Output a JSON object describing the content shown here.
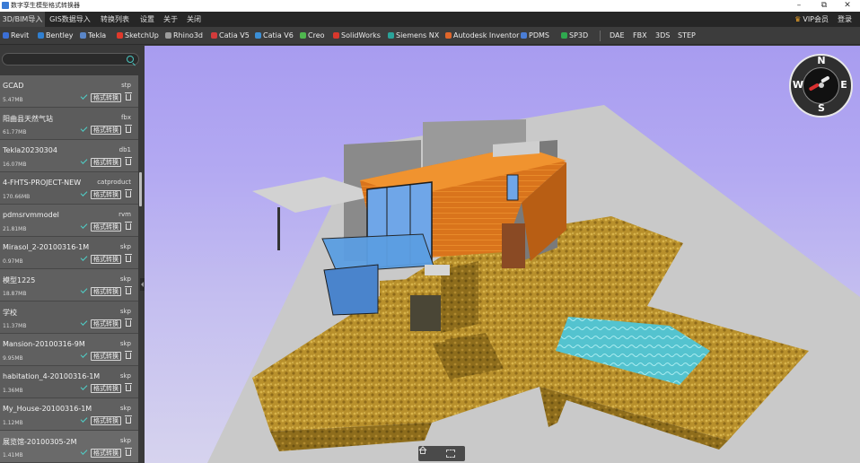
{
  "window": {
    "title": "数字孪生模型格式转换器",
    "controls": [
      "–",
      "⧉",
      "✕"
    ]
  },
  "menu": {
    "items": [
      {
        "label": "3D/BIM导入",
        "active": true
      },
      {
        "label": "GIS数据导入",
        "active": false
      },
      {
        "label": "转换列表",
        "active": false
      },
      {
        "label": "设置",
        "active": false
      },
      {
        "label": "关于",
        "active": false
      },
      {
        "label": "关闭",
        "active": false
      }
    ],
    "vip_label": "VIP会员",
    "login_label": "登录"
  },
  "formats": {
    "items": [
      {
        "label": "Revit",
        "icon": "revit-icon",
        "color": "#3b6fd6"
      },
      {
        "label": "Bentley",
        "icon": "bentley-icon",
        "color": "#2f7fd0"
      },
      {
        "label": "Tekla",
        "icon": "tekla-icon",
        "color": "#5a86c8"
      },
      {
        "label": "SketchUp",
        "icon": "sketchup-icon",
        "color": "#e0392b"
      },
      {
        "label": "Rhino3d",
        "icon": "rhino3d-icon",
        "color": "#9c9c9c"
      },
      {
        "label": "Catia V5",
        "icon": "catia-v5-icon",
        "color": "#d23b3b"
      },
      {
        "label": "Catia V6",
        "icon": "catia-v6-icon",
        "color": "#3b8fd6"
      },
      {
        "label": "Creo",
        "icon": "creo-icon",
        "color": "#4fb74f"
      },
      {
        "label": "SolidWorks",
        "icon": "solidworks-icon",
        "color": "#d8372c"
      },
      {
        "label": "Siemens NX",
        "icon": "siemens-nx-icon",
        "color": "#2aa39a"
      },
      {
        "label": "Autodesk Inventor",
        "icon": "inventor-icon",
        "color": "#e0662a"
      },
      {
        "label": "PDMS",
        "icon": "pdms-icon",
        "color": "#4a7ed6"
      },
      {
        "label": "SP3D",
        "icon": "sp3d-icon",
        "color": "#2fa84f"
      }
    ],
    "plain": [
      "DAE",
      "FBX",
      "3DS",
      "STEP"
    ]
  },
  "sidebar": {
    "search_placeholder": "",
    "convert_label": "格式转换",
    "files": [
      {
        "name": "GCAD",
        "ext": "stp",
        "size": "5.47MB"
      },
      {
        "name": "阳曲县天然气站",
        "ext": "fbx",
        "size": "61.77MB"
      },
      {
        "name": "Tekla20230304",
        "ext": "db1",
        "size": "16.07MB"
      },
      {
        "name": "4-FHTS-PROJECT-NEW",
        "ext": "catproduct",
        "size": "170.66MB"
      },
      {
        "name": "pdmsrvmmodel",
        "ext": "rvm",
        "size": "21.81MB"
      },
      {
        "name": "Mirasol_2-20100316-1M",
        "ext": "skp",
        "size": "0.97MB"
      },
      {
        "name": "模型1225",
        "ext": "skp",
        "size": "18.87MB"
      },
      {
        "name": "学校",
        "ext": "skp",
        "size": "11.37MB"
      },
      {
        "name": "Mansion-20100316-9M",
        "ext": "skp",
        "size": "9.95MB"
      },
      {
        "name": "habitation_4-20100316-1M",
        "ext": "skp",
        "size": "1.36MB"
      },
      {
        "name": "My_House-20100316-1M",
        "ext": "skp",
        "size": "1.12MB"
      },
      {
        "name": "展览馆-20100305-2M",
        "ext": "skp",
        "size": "1.41MB",
        "selected": true
      }
    ]
  },
  "compass": {
    "n": "N",
    "s": "S",
    "e": "E",
    "w": "W"
  },
  "colors": {
    "accent": "#49c5c0",
    "viewport_bg": "#b3a9f2",
    "menu_bg": "#262626"
  }
}
